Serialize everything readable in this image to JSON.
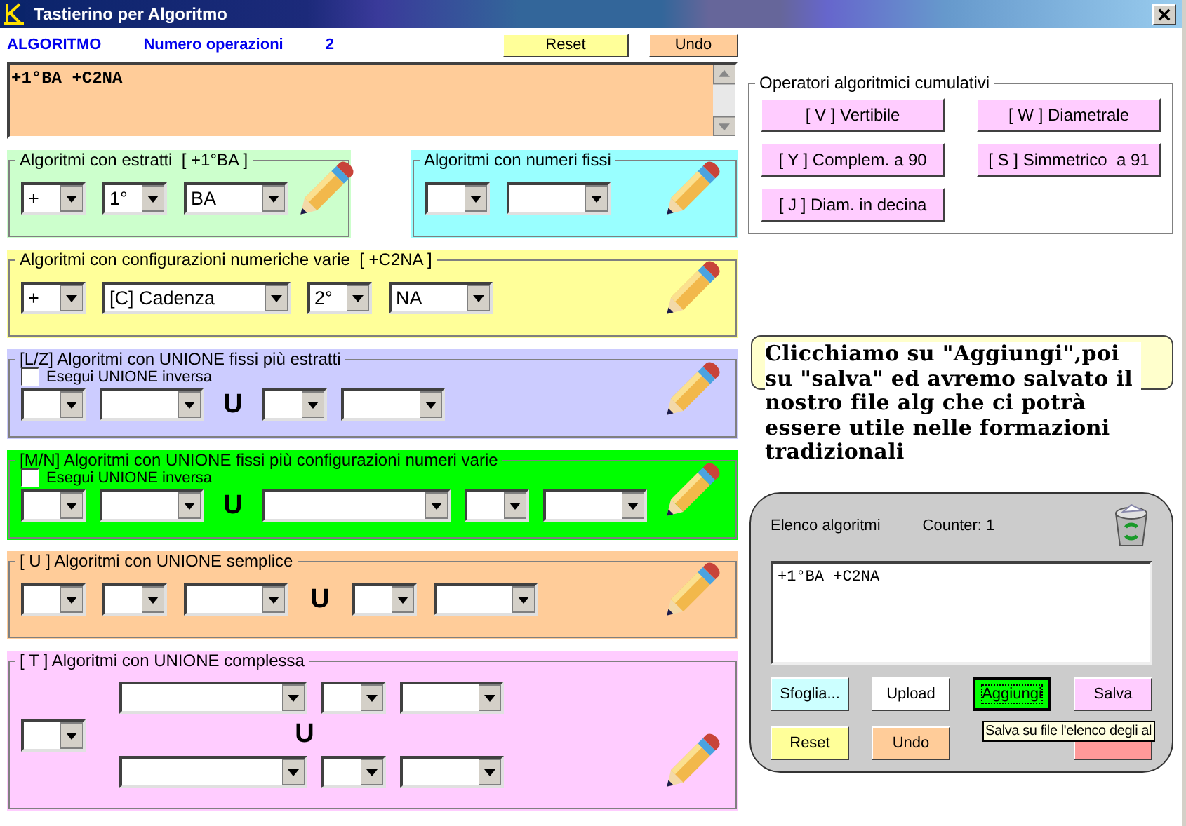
{
  "window": {
    "title": "Tastierino per Algoritmo"
  },
  "header": {
    "label": "ALGORITMO",
    "count_label": "Numero operazioni",
    "count": "2",
    "buttons": [
      {
        "label": "Reset",
        "color": "#ffff99"
      },
      {
        "label": "Undo",
        "color": "#ffcc99"
      }
    ]
  },
  "expression": "+1°BA +C2NA",
  "top_panels": [
    {
      "title": "Algoritmi con estratti  [ +1°BA ]",
      "color": "#ccffcc",
      "kind": "simple",
      "items": [
        {
          "kind": "short",
          "value": "+"
        },
        {
          "kind": "short",
          "value": "1°"
        },
        {
          "kind": "medium",
          "value": "BA"
        }
      ]
    },
    {
      "title": "Algoritmi con numeri fissi",
      "color": "#99ffff",
      "kind": "simple",
      "items": [
        {
          "kind": "short"
        },
        {
          "kind": "medium"
        }
      ]
    }
  ],
  "panels": [
    {
      "title": "Algoritmi con configurazioni numeriche varie  [ +C2NA ]",
      "color": "#ffff99",
      "kind": "simple",
      "items": [
        {
          "kind": "short",
          "value": "+"
        },
        {
          "kind": "long",
          "value": "[C] Cadenza"
        },
        {
          "kind": "short",
          "value": "2°"
        },
        {
          "kind": "medium",
          "value": "NA"
        }
      ]
    },
    {
      "title": "[L/Z] Algoritmi con UNIONE fissi più estratti",
      "color": "#ccccff",
      "kind": "checkbox",
      "checkbox": {
        "label": "Esegui UNIONE inversa",
        "checked": false
      },
      "items": [
        {
          "kind": "short"
        },
        {
          "kind": "medium"
        },
        {
          "kind": "union",
          "text": "U"
        },
        {
          "kind": "short"
        },
        {
          "kind": "medium"
        }
      ]
    },
    {
      "title": "[M/N] Algoritmi con UNIONE fissi più configurazioni numeri varie",
      "color": "#00ff00",
      "kind": "checkbox",
      "checkbox": {
        "label": "Esegui UNIONE inversa",
        "checked": false
      },
      "items": [
        {
          "kind": "short"
        },
        {
          "kind": "medium"
        },
        {
          "kind": "union",
          "text": "U"
        },
        {
          "kind": "long"
        },
        {
          "kind": "short"
        },
        {
          "kind": "medium"
        }
      ]
    },
    {
      "title": "[ U ] Algoritmi con UNIONE semplice",
      "color": "#ffcc99",
      "kind": "simple",
      "items": [
        {
          "kind": "short"
        },
        {
          "kind": "short"
        },
        {
          "kind": "medium"
        },
        {
          "kind": "union",
          "text": "U"
        },
        {
          "kind": "short"
        },
        {
          "kind": "medium"
        }
      ]
    },
    {
      "title": "[ T ] Algoritmi con UNIONE complessa",
      "color": "#ffccff",
      "kind": "stacked",
      "lead": {
        "kind": "short"
      },
      "rows": [
        [
          {
            "kind": "long"
          },
          {
            "kind": "short"
          },
          {
            "kind": "medium"
          }
        ],
        [
          {
            "kind": "union",
            "text": "U"
          }
        ],
        [
          {
            "kind": "long"
          },
          {
            "kind": "short"
          },
          {
            "kind": "medium"
          }
        ]
      ]
    }
  ],
  "operators": {
    "title": "Operatori algoritmici cumulativi",
    "buttons": [
      "[ V ] Vertibile",
      "[ W ] Diametrale",
      "[ Y ] Complem. a 90",
      "[ S ] Simmetrico  a 91",
      "[ J ] Diam. in decina"
    ]
  },
  "note": "Clicchiamo su \"Aggiungi\",poi su \"salva\" ed avremo salvato il nostro file alg che ci potrà essere utile nelle formazioni tradizionali",
  "list_panel": {
    "title": "Elenco algoritmi",
    "counter": "Counter: 1",
    "content": "+1°BA +C2NA",
    "buttons": [
      {
        "label": "Sfoglia...",
        "color": "#ccffff",
        "focused": false
      },
      {
        "label": "Upload",
        "color": "#ffffff",
        "focused": false
      },
      {
        "label": "Aggiungi",
        "color": "#00ff00",
        "focused": true
      },
      {
        "label": "Salva",
        "color": "#ffccff",
        "focused": false
      },
      {
        "label": "Reset",
        "color": "#ffff99",
        "focused": false
      },
      {
        "label": "Undo",
        "color": "#ffcc99",
        "focused": false
      },
      {
        "color": "#ff9999",
        "focused": false
      }
    ],
    "tooltip": "Salva su file l'elenco degli al"
  }
}
